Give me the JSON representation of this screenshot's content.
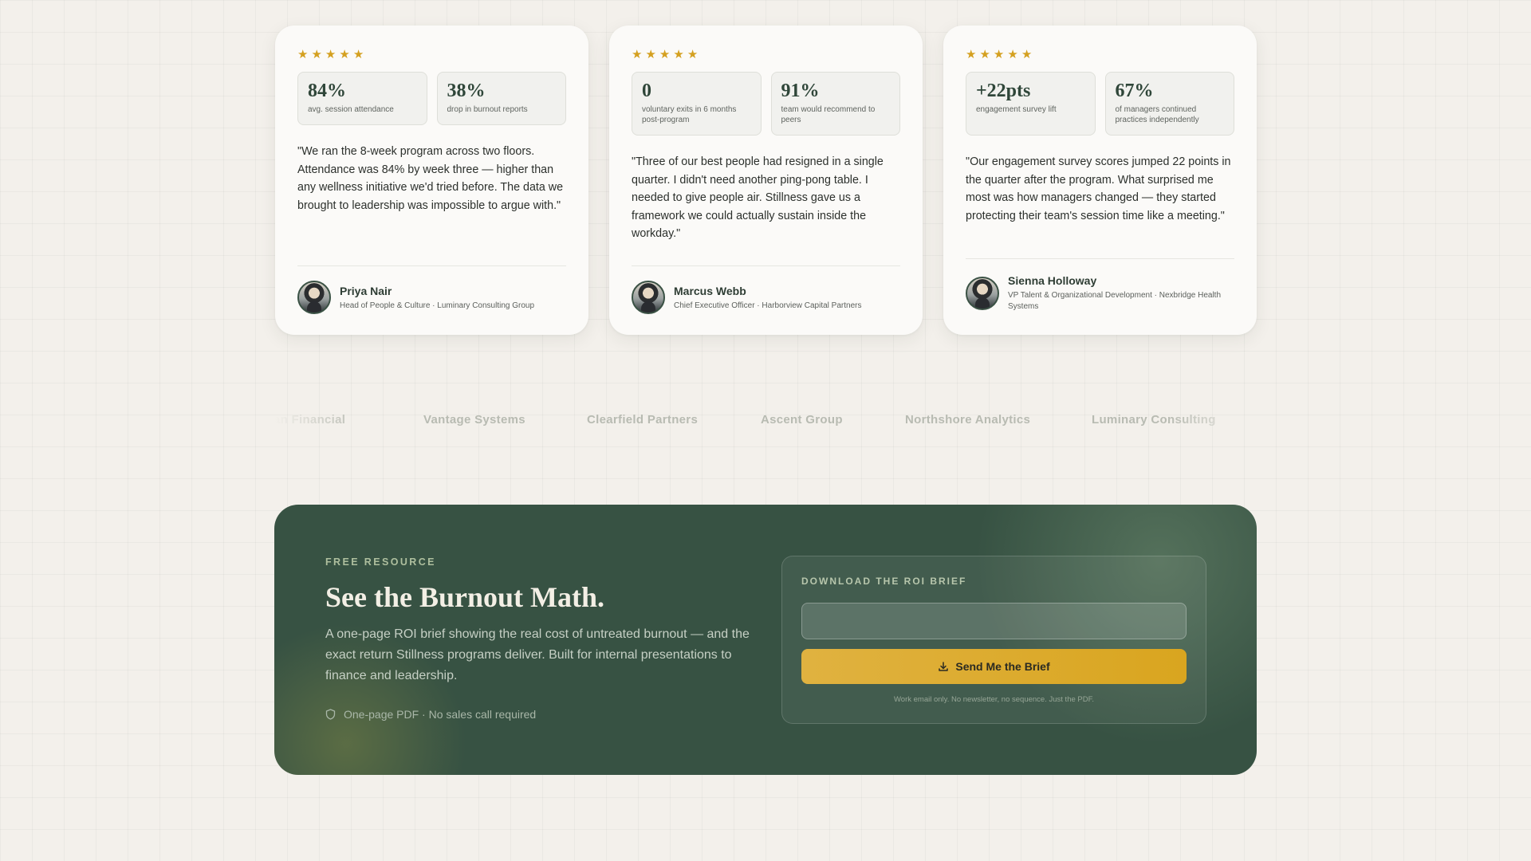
{
  "testimonials": [
    {
      "rating": 5,
      "metrics": [
        {
          "value": "84%",
          "label": "avg. session attendance"
        },
        {
          "value": "38%",
          "label": "drop in burnout reports"
        }
      ],
      "quote": "\"We ran the 8-week program across two floors. Attendance was 84% by week three — higher than any wellness initiative we'd tried before. The data we brought to leadership was impossible to argue with.\"",
      "name": "Priya Nair",
      "role": "Head of People & Culture · Luminary Consulting Group"
    },
    {
      "rating": 5,
      "metrics": [
        {
          "value": "0",
          "label": "voluntary exits in 6 months post-program"
        },
        {
          "value": "91%",
          "label": "team would recommend to peers"
        }
      ],
      "quote": "\"Three of our best people had resigned in a single quarter. I didn't need another ping-pong table. I needed to give people air. Stillness gave us a framework we could actually sustain inside the workday.\"",
      "name": "Marcus Webb",
      "role": "Chief Executive Officer · Harborview Capital Partners"
    },
    {
      "rating": 5,
      "metrics": [
        {
          "value": "+22pts",
          "label": "engagement survey lift"
        },
        {
          "value": "67%",
          "label": "of managers continued practices independently"
        }
      ],
      "quote": "\"Our engagement survey scores jumped 22 points in the quarter after the program. What surprised me most was how managers changed — they started protecting their team's session time like a meeting.\"",
      "name": "Sienna Holloway",
      "role": "VP Talent & Organizational Development · Nexbridge Health Systems"
    }
  ],
  "logos": [
    "Meridian Financial",
    "Vantage Systems",
    "Clearfield Partners",
    "Ascent Group",
    "Northshore Analytics",
    "Luminary Consulting"
  ],
  "cta": {
    "eyebrow": "FREE RESOURCE",
    "title": "See the Burnout Math.",
    "description": "A one-page ROI brief showing the real cost of untreated burnout — and the exact return Stillness programs deliver. Built for internal presentations to finance and leadership.",
    "note": "One-page PDF · No sales call required",
    "form": {
      "title": "DOWNLOAD THE ROI BRIEF",
      "email_value": "",
      "button_label": "Send Me the Brief",
      "fine_print": "Work email only. No newsletter, no sequence. Just the PDF."
    }
  },
  "colors": {
    "page_bg": "#f3f0eb",
    "cta_bg": "#375243",
    "accent_gold": "#d9a51f",
    "star": "#d4a020"
  },
  "icons": {
    "star": "star-icon",
    "note": "shield-icon",
    "button": "download-icon"
  }
}
